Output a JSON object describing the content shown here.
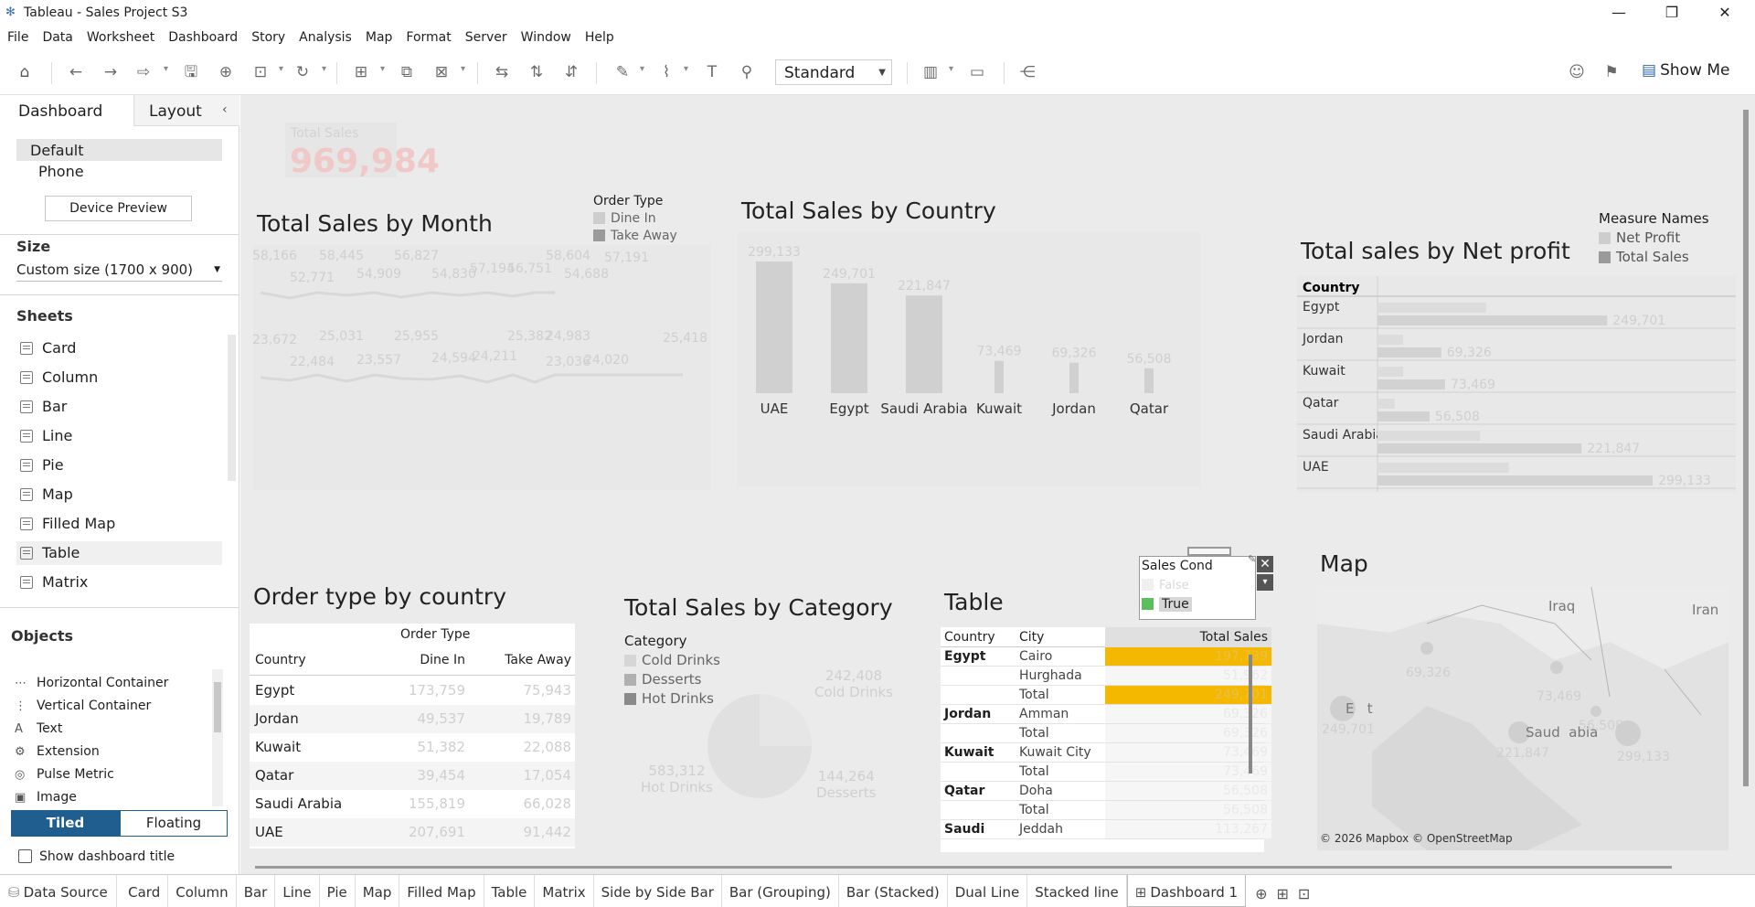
{
  "window": {
    "title": "Tableau - Sales Project S3"
  },
  "menu": [
    "File",
    "Data",
    "Worksheet",
    "Dashboard",
    "Story",
    "Analysis",
    "Map",
    "Format",
    "Server",
    "Window",
    "Help"
  ],
  "toolbar": {
    "view_select": "Standard",
    "show_me": "Show Me"
  },
  "left": {
    "tabs": [
      "Dashboard",
      "Layout"
    ],
    "devices": [
      "Default",
      "Phone"
    ],
    "device_preview": "Device Preview",
    "size_title": "Size",
    "size_value": "Custom size (1700 x 900)",
    "sheets_title": "Sheets",
    "sheets": [
      "Card",
      "Column",
      "Bar",
      "Line",
      "Pie",
      "Map",
      "Filled Map",
      "Table",
      "Matrix"
    ],
    "objects_title": "Objects",
    "objects": [
      "Horizontal Container",
      "Vertical Container",
      "Text",
      "Extension",
      "Pulse Metric",
      "Image"
    ],
    "tiled": "Tiled",
    "floating": "Floating",
    "show_title": "Show dashboard title"
  },
  "card": {
    "label": "Total Sales",
    "value": "969,984"
  },
  "month": {
    "title": "Total Sales by Month",
    "legend_title": "Order Type",
    "legend": [
      "Dine In",
      "Take Away"
    ],
    "take_away": [
      "58,166",
      "52,771",
      "58,445",
      "54,909",
      "56,827",
      "54,830",
      "57,194",
      "56,751",
      "58,604",
      "54,688",
      "57,191"
    ],
    "dine_in": [
      "23,672",
      "22,484",
      "25,031",
      "23,557",
      "25,955",
      "24,594",
      "24,211",
      "25,382",
      "23,036",
      "24,983",
      "24,020",
      "25,418"
    ]
  },
  "country": {
    "title": "Total Sales by Country"
  },
  "chart_data": [
    {
      "type": "bar",
      "title": "Total Sales by Country",
      "categories": [
        "UAE",
        "Egypt",
        "Saudi Arabia",
        "Kuwait",
        "Jordan",
        "Qatar"
      ],
      "values": [
        299133,
        249701,
        221847,
        73469,
        69326,
        56508
      ],
      "labels": [
        "299,133",
        "249,701",
        "221,847",
        "73,469",
        "69,326",
        "56,508"
      ],
      "ylim": [
        0,
        320000
      ]
    },
    {
      "type": "bar",
      "title": "Total sales by Net profit",
      "categories": [
        "Egypt",
        "Jordan",
        "Kuwait",
        "Qatar",
        "Saudi Arabia",
        "UAE"
      ],
      "series": [
        {
          "name": "Total Sales",
          "values": [
            249701,
            69326,
            73469,
            56508,
            221847,
            299133
          ]
        }
      ],
      "labels": [
        "249,701",
        "69,326",
        "73,469",
        "56,508",
        "221,847",
        "299,133"
      ]
    }
  ],
  "netprofit": {
    "title": "Total sales by Net profit",
    "legend_title": "Measure Names",
    "legend": [
      "Net Profit",
      "Total Sales"
    ],
    "col_header": "Country",
    "rows": [
      "Egypt",
      "Jordan",
      "Kuwait",
      "Qatar",
      "Saudi Arabia",
      "UAE"
    ]
  },
  "order": {
    "title": "Order type by country",
    "group": "Order Type",
    "cols": [
      "Country",
      "Dine In",
      "Take Away"
    ],
    "rows": [
      [
        "Egypt",
        "173,759",
        "75,943"
      ],
      [
        "Jordan",
        "49,537",
        "19,789"
      ],
      [
        "Kuwait",
        "51,382",
        "22,088"
      ],
      [
        "Qatar",
        "39,454",
        "17,054"
      ],
      [
        "Saudi Arabia",
        "155,819",
        "66,028"
      ],
      [
        "UAE",
        "207,691",
        "91,442"
      ]
    ]
  },
  "category": {
    "title": "Total Sales by Category",
    "legend_title": "Category",
    "legend": [
      "Cold Drinks",
      "Desserts",
      "Hot Drinks"
    ],
    "labels": [
      {
        "v": "242,408",
        "n": "Cold Drinks"
      },
      {
        "v": "144,264",
        "n": "Desserts"
      },
      {
        "v": "583,312",
        "n": "Hot Drinks"
      }
    ]
  },
  "table": {
    "title": "Table",
    "cols": [
      "Country",
      "City",
      "Total Sales"
    ],
    "rows": [
      [
        "Egypt",
        "Cairo",
        "197,739"
      ],
      [
        "",
        "Hurghada",
        "51,962"
      ],
      [
        "",
        "Total",
        "249,701"
      ],
      [
        "Jordan",
        "Amman",
        "69,326"
      ],
      [
        "",
        "Total",
        "69,326"
      ],
      [
        "Kuwait",
        "Kuwait City",
        "73,469"
      ],
      [
        "",
        "Total",
        "73,469"
      ],
      [
        "Qatar",
        "Doha",
        "56,508"
      ],
      [
        "",
        "Total",
        "56,508"
      ],
      [
        "Saudi",
        "Jeddah",
        "113,267"
      ]
    ]
  },
  "filter": {
    "title": "Sales Cond",
    "options": [
      "False",
      "True"
    ]
  },
  "map": {
    "title": "Map",
    "labels": [
      "Iraq",
      "Iran",
      "E   t",
      "Saud  abia"
    ],
    "values": [
      "69,326",
      "73,469",
      "249,701",
      "56,508",
      "221,847",
      "299,133"
    ],
    "credit": "© 2026 Mapbox © OpenStreetMap"
  },
  "bottom": {
    "datasource": "Data Source",
    "tabs": [
      "Card",
      "Column",
      "Bar",
      "Line",
      "Pie",
      "Map",
      "Filled Map",
      "Table",
      "Matrix",
      "Side by Side Bar",
      "Bar (Grouping)",
      "Bar (Stacked)",
      "Dual Line",
      "Stacked line",
      "Dashboard 1"
    ]
  },
  "colors": {
    "accent": "#1f5e8f",
    "highlight": "#f5b800",
    "true_swatch": "#5bbf5b"
  }
}
